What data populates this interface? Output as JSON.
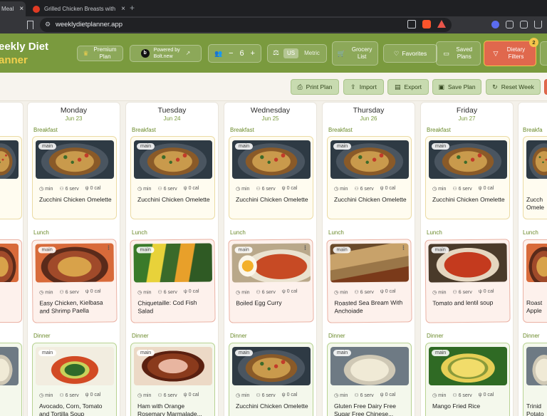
{
  "browser": {
    "tabs": [
      {
        "label": "Meal",
        "active": true
      },
      {
        "label": "Grilled Chicken Breasts with Spicy Pe",
        "active": false
      }
    ],
    "url": "weeklydietplanner.app"
  },
  "header": {
    "brand_line1": "eekly Diet",
    "brand_line2": "anner",
    "premium_label": "Premium Plan",
    "bolt_line1": "Powered by",
    "bolt_line2": "Bolt.new",
    "servings": "6",
    "unit_us": "US",
    "unit_metric": "Metric",
    "grocery_label": "Grocery List",
    "favorites_label": "Favorites",
    "saved_label": "Saved Plans",
    "dietary_label": "Dietary Filters",
    "dietary_badge": "2"
  },
  "toolbar": {
    "print": "Print Plan",
    "import": "Import",
    "export": "Export",
    "save": "Save Plan",
    "reset": "Reset Week"
  },
  "meal_labels": {
    "breakfast": "Breakfast",
    "lunch": "Lunch",
    "dinner": "Dinner"
  },
  "card_meta": {
    "time": "min",
    "servings": "6 serv",
    "calories": "0 cal",
    "chip": "main"
  },
  "days": [
    {
      "name": "Monday",
      "date": "Jun 23",
      "breakfast": "Zucchini Chicken Omelette",
      "lunch": "Easy Chicken, Kielbasa and Shrimp Paella",
      "dinner": "Avocado, Corn, Tomato and Tortilla Soup"
    },
    {
      "name": "Tuesday",
      "date": "Jun 24",
      "breakfast": "Zucchini Chicken Omelette",
      "lunch": "Chiquetaille: Cod Fish Salad",
      "dinner": "Ham with Orange Rosemary Marmalade..."
    },
    {
      "name": "Wednesday",
      "date": "Jun 25",
      "breakfast": "Zucchini Chicken Omelette",
      "lunch": "Boiled Egg Curry",
      "dinner": "Zucchini Chicken Omelette"
    },
    {
      "name": "Thursday",
      "date": "Jun 26",
      "breakfast": "Zucchini Chicken Omelette",
      "lunch": "Roasted Sea Bream With Anchoiade",
      "dinner": "Gluten Free Dairy Free Sugar Free Chinese..."
    },
    {
      "name": "Friday",
      "date": "Jun 27",
      "breakfast": "Zucchini Chicken Omelette",
      "lunch": "Tomato and lentil soup",
      "dinner": "Mango Fried Rice"
    }
  ],
  "right_partial": {
    "breakfast_label": "Breakfa",
    "b_line1": "Zucch",
    "b_line2": "Omele",
    "lunch_label": "Lunch",
    "l_line1": "Roast",
    "l_line2": "Apple",
    "dinner_label": "Dinner",
    "d_line1": "Trinid",
    "d_line2": "Potato"
  },
  "colors": {
    "header_green": "#7a9a3e",
    "accent_yellow": "#f1d04d",
    "dietary_red": "#e0684d",
    "toolbar_green": "#c8dbb0"
  }
}
